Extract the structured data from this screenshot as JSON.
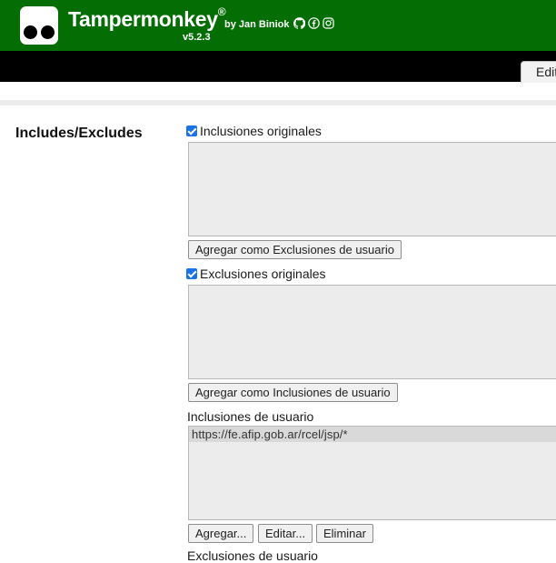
{
  "header": {
    "title": "Tampermonkey",
    "registered": "®",
    "byline": "by Jan Biniok",
    "version": "v5.2.3",
    "social_icons": [
      "github-icon",
      "facebook-icon",
      "instagram-icon"
    ],
    "background_color": "#046e04"
  },
  "tabs": [
    {
      "label": "Editor"
    }
  ],
  "section": {
    "title": "Includes/Excludes",
    "original_includes": {
      "label": "Inclusiones originales",
      "checked": true,
      "value": "",
      "button_label": "Agregar como Exclusiones de usuario"
    },
    "original_excludes": {
      "label": "Exclusiones originales",
      "checked": true,
      "value": "",
      "button_label": "Agregar como Inclusiones de usuario"
    },
    "user_includes": {
      "label": "Inclusiones de usuario",
      "items": [
        "https://fe.afip.gob.ar/rcel/jsp/*"
      ],
      "add_label": "Agregar...",
      "edit_label": "Editar...",
      "delete_label": "Eliminar"
    },
    "user_excludes": {
      "label": "Exclusiones de usuario"
    }
  }
}
